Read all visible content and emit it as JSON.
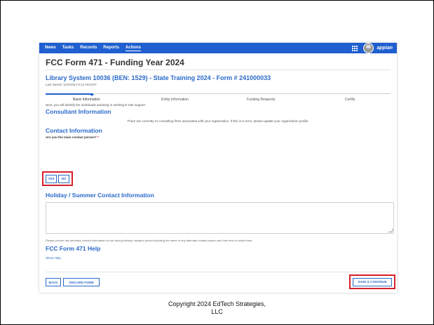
{
  "nav": {
    "items": [
      "News",
      "Tasks",
      "Records",
      "Reports",
      "Actions"
    ],
    "active_index": 4,
    "brand": "appian",
    "icons": [
      "apps-grid-icon",
      "user-avatar-icon"
    ]
  },
  "form": {
    "title": "FCC Form 471 - Funding Year 2024",
    "subtitle": "Library System 10036 (BEN: 1529) - State Training 2024 - Form # 241000033",
    "last_saved": "Last Saved: 1/22/2024 9:12 AM EST"
  },
  "progress": {
    "steps": [
      "Basic Information",
      "Entity Information",
      "Funding Requests",
      "Certify"
    ],
    "current_step": 0
  },
  "page": {
    "intro": "Next, you will identify the individuals assisting in seeking E-rate support.",
    "consultant_heading": "Consultant Information",
    "consultant_message": "There are currently no consulting firms associated with your organization. If this is in error, please update your organization profile.",
    "contact_heading": "Contact Information",
    "main_contact_question": "Are you the main contact person?",
    "required_marker": "*",
    "yes_label": "YES",
    "no_label": "NO",
    "holiday_heading": "Holiday / Summer Contact Information",
    "holiday_value": "",
    "holiday_hint": "Please provide any alternate contact information to use during holiday/ vacation period including the name of any alternate contact person and how best to reach them.",
    "help_heading": "FCC Form 471 Help",
    "show_help": "Show Help"
  },
  "footer": {
    "back_label": "BACK",
    "discard_label": "DISCARD FORM",
    "save_label": "SAVE & CONTINUE"
  },
  "slide": {
    "copyright_line1": "Copyright 2024 EdTech Strategies,",
    "copyright_line2": "LLC"
  },
  "colors": {
    "nav_bar": "#1f5fcf",
    "heading_blue": "#2a6ac9",
    "highlight_red": "#d61f2c"
  }
}
